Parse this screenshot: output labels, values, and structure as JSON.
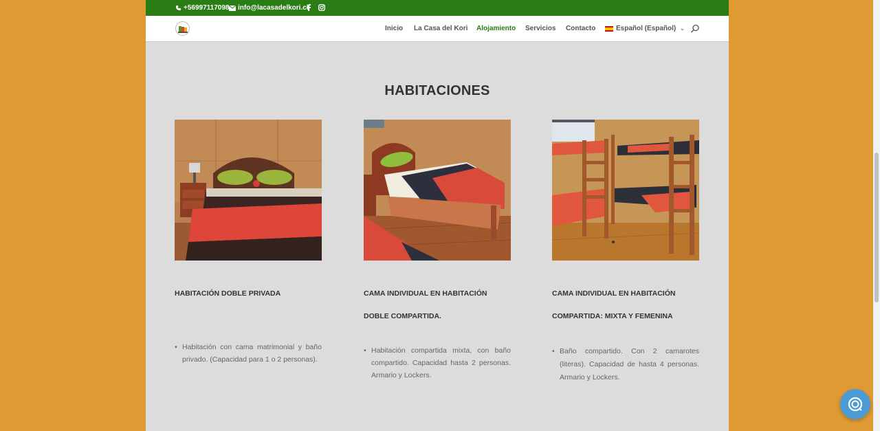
{
  "topbar": {
    "phone": "+56997117098",
    "email": "info@lacasadelkori.cl",
    "colors": {
      "bar": "#2a7d14"
    },
    "icons": [
      "phone-icon",
      "mail-icon",
      "facebook-icon",
      "instagram-icon"
    ]
  },
  "header": {
    "logo_icon": "site-logo",
    "nav": [
      {
        "label": "Inicio"
      },
      {
        "label": "La Casa del Kori"
      },
      {
        "label": "Alojamiento",
        "active": true
      },
      {
        "label": "Servicios"
      },
      {
        "label": "Contacto"
      }
    ],
    "language": "Español (Español)",
    "search_icon": "search-icon"
  },
  "main": {
    "title": "HABITACIONES",
    "rooms": [
      {
        "title": [
          "HABITACIÓN DOBLE PRIVADA"
        ],
        "description": "Habitación con cama matrimonial y baño privado. (Capacidad para 1 o 2 personas)."
      },
      {
        "title": [
          "CAMA INDIVIDUAL EN HABITACIÓN",
          "DOBLE COMPARTIDA."
        ],
        "description": "Habitación compartida mixta, con baño compartido. Capacidad hasta 2 personas. Armario y Lockers."
      },
      {
        "title": [
          "CAMA INDIVIDUAL EN HABITACIÓN",
          "COMPARTIDA: MIXTA Y FEMENINA"
        ],
        "description": "Baño compartido. Con 2 camarotes (literas). Capacidad de hasta 4 personas. Armario y Lockers."
      }
    ]
  },
  "colors": {
    "page_bg": "#df9a34",
    "content_bg": "#dcdcdc",
    "accent": "#2a7d14",
    "help_button": "#4a9bd6"
  },
  "help_icon": "chat-help-icon"
}
